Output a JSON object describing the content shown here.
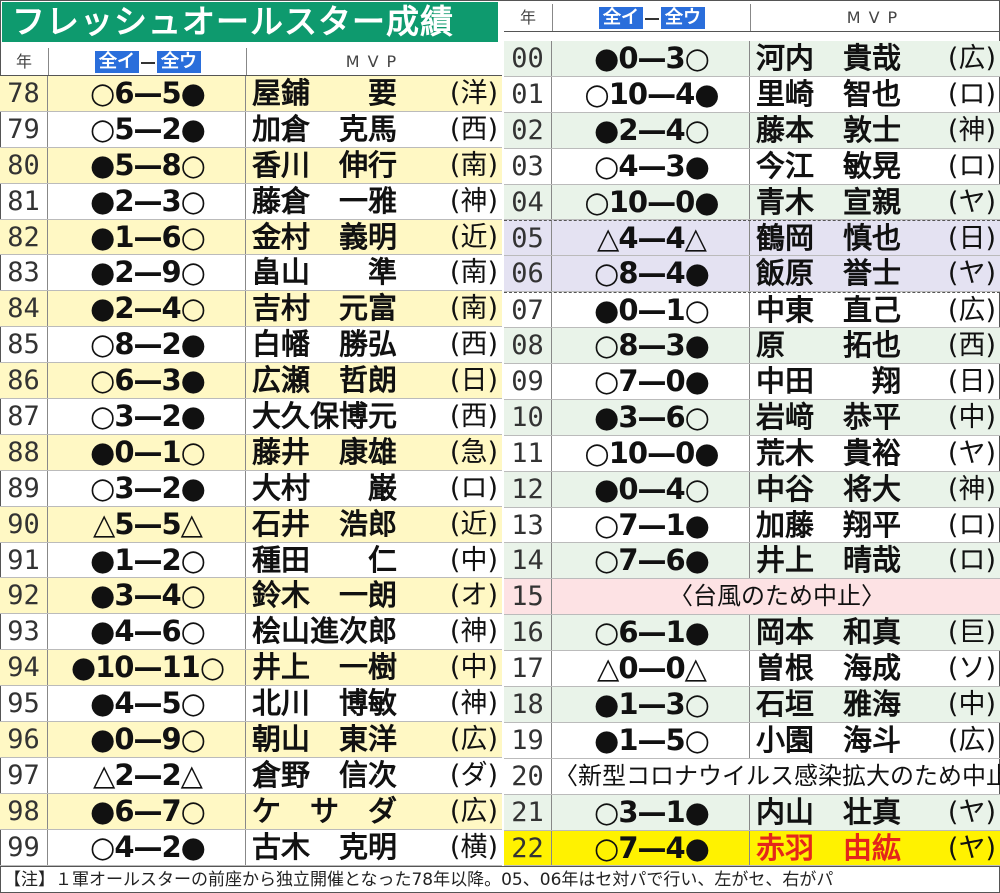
{
  "title": "フレッシュオールスター成績",
  "header": {
    "year": "年",
    "score_left": "全イ",
    "score_right": "全ウ",
    "mvp": "MVP"
  },
  "left_rows": [
    {
      "yr": "78",
      "score": "○6—5●",
      "name": "屋鋪　　要",
      "team": "(洋)",
      "hl": "y"
    },
    {
      "yr": "79",
      "score": "○5—2●",
      "name": "加倉　克馬",
      "team": "(西)",
      "hl": ""
    },
    {
      "yr": "80",
      "score": "●5—8○",
      "name": "香川　伸行",
      "team": "(南)",
      "hl": "y"
    },
    {
      "yr": "81",
      "score": "●2—3○",
      "name": "藤倉　一雅",
      "team": "(神)",
      "hl": ""
    },
    {
      "yr": "82",
      "score": "●1—6○",
      "name": "金村　義明",
      "team": "(近)",
      "hl": "y"
    },
    {
      "yr": "83",
      "score": "●2—9○",
      "name": "畠山　　準",
      "team": "(南)",
      "hl": ""
    },
    {
      "yr": "84",
      "score": "●2—4○",
      "name": "吉村　元富",
      "team": "(南)",
      "hl": "y"
    },
    {
      "yr": "85",
      "score": "○8—2●",
      "name": "白幡　勝弘",
      "team": "(西)",
      "hl": ""
    },
    {
      "yr": "86",
      "score": "○6—3●",
      "name": "広瀬　哲朗",
      "team": "(日)",
      "hl": "y"
    },
    {
      "yr": "87",
      "score": "○3—2●",
      "name": "大久保博元",
      "team": "(西)",
      "hl": ""
    },
    {
      "yr": "88",
      "score": "●0—1○",
      "name": "藤井　康雄",
      "team": "(急)",
      "hl": "y"
    },
    {
      "yr": "89",
      "score": "○3—2●",
      "name": "大村　　巌",
      "team": "(ロ)",
      "hl": ""
    },
    {
      "yr": "90",
      "score": "△5—5△",
      "name": "石井　浩郎",
      "team": "(近)",
      "hl": "y"
    },
    {
      "yr": "91",
      "score": "●1—2○",
      "name": "種田　　仁",
      "team": "(中)",
      "hl": ""
    },
    {
      "yr": "92",
      "score": "●3—4○",
      "name": "鈴木　一朗",
      "team": "(オ)",
      "hl": "y"
    },
    {
      "yr": "93",
      "score": "●4—6○",
      "name": "桧山進次郎",
      "team": "(神)",
      "hl": ""
    },
    {
      "yr": "94",
      "score": "●10—11○",
      "name": "井上　一樹",
      "team": "(中)",
      "hl": "y"
    },
    {
      "yr": "95",
      "score": "●4—5○",
      "name": "北川　博敏",
      "team": "(神)",
      "hl": ""
    },
    {
      "yr": "96",
      "score": "●0—9○",
      "name": "朝山　東洋",
      "team": "(広)",
      "hl": "y"
    },
    {
      "yr": "97",
      "score": "△2—2△",
      "name": "倉野　信次",
      "team": "(ダ)",
      "hl": ""
    },
    {
      "yr": "98",
      "score": "●6—7○",
      "name": "ケ　サ　ダ",
      "team": "(広)",
      "hl": "y"
    },
    {
      "yr": "99",
      "score": "○4—2●",
      "name": "古木　克明",
      "team": "(横)",
      "hl": ""
    }
  ],
  "right_rows": [
    {
      "yr": "00",
      "score": "●0—3○",
      "name": "河内　貴哉",
      "team": "(広)",
      "hl": "g"
    },
    {
      "yr": "01",
      "score": "○10—4●",
      "name": "里崎　智也",
      "team": "(ロ)",
      "hl": ""
    },
    {
      "yr": "02",
      "score": "●2—4○",
      "name": "藤本　敦士",
      "team": "(神)",
      "hl": "g"
    },
    {
      "yr": "03",
      "score": "○4—3●",
      "name": "今江　敏晃",
      "team": "(ロ)",
      "hl": ""
    },
    {
      "yr": "04",
      "score": "○10—0●",
      "name": "青木　宣親",
      "team": "(ヤ)",
      "hl": "g"
    },
    {
      "yr": "05",
      "score": "△4—4△",
      "name": "鶴岡　慎也",
      "team": "(日)",
      "hl": "p"
    },
    {
      "yr": "06",
      "score": "○8—4●",
      "name": "飯原　誉士",
      "team": "(ヤ)",
      "hl": "p"
    },
    {
      "yr": "07",
      "score": "●0—1○",
      "name": "中東　直己",
      "team": "(広)",
      "hl": ""
    },
    {
      "yr": "08",
      "score": "○8—3●",
      "name": "原　　拓也",
      "team": "(西)",
      "hl": "g"
    },
    {
      "yr": "09",
      "score": "○7—0●",
      "name": "中田　　翔",
      "team": "(日)",
      "hl": ""
    },
    {
      "yr": "10",
      "score": "●3—6○",
      "name": "岩﨑　恭平",
      "team": "(中)",
      "hl": "g"
    },
    {
      "yr": "11",
      "score": "○10—0●",
      "name": "荒木　貴裕",
      "team": "(ヤ)",
      "hl": ""
    },
    {
      "yr": "12",
      "score": "●0—4○",
      "name": "中谷　将大",
      "team": "(神)",
      "hl": "g"
    },
    {
      "yr": "13",
      "score": "○7—1●",
      "name": "加藤　翔平",
      "team": "(ロ)",
      "hl": ""
    },
    {
      "yr": "14",
      "score": "○7—6●",
      "name": "井上　晴哉",
      "team": "(ロ)",
      "hl": "g"
    },
    {
      "yr": "15",
      "note": "〈台風のため中止〉",
      "hl": "pk"
    },
    {
      "yr": "16",
      "score": "○6—1●",
      "name": "岡本　和真",
      "team": "(巨)",
      "hl": "g"
    },
    {
      "yr": "17",
      "score": "△0—0△",
      "name": "曽根　海成",
      "team": "(ソ)",
      "hl": ""
    },
    {
      "yr": "18",
      "score": "●1—3○",
      "name": "石垣　雅海",
      "team": "(中)",
      "hl": "g"
    },
    {
      "yr": "19",
      "score": "●1—5○",
      "name": "小園　海斗",
      "team": "(広)",
      "hl": ""
    },
    {
      "yr": "20",
      "note": "〈新型コロナウイルス感染拡大のため中止〉",
      "hl": ""
    },
    {
      "yr": "21",
      "score": "○3—1●",
      "name": "内山　壮真",
      "team": "(ヤ)",
      "hl": "g"
    },
    {
      "yr": "22",
      "score": "○7—4●",
      "name": "赤羽　由紘",
      "team": "(ヤ)",
      "hl": "gold",
      "red": true
    }
  ],
  "footnote": "【注】１軍オールスターの前座から独立開催となった78年以降。05、06年はセ対パで行い、左がセ、右がパ"
}
